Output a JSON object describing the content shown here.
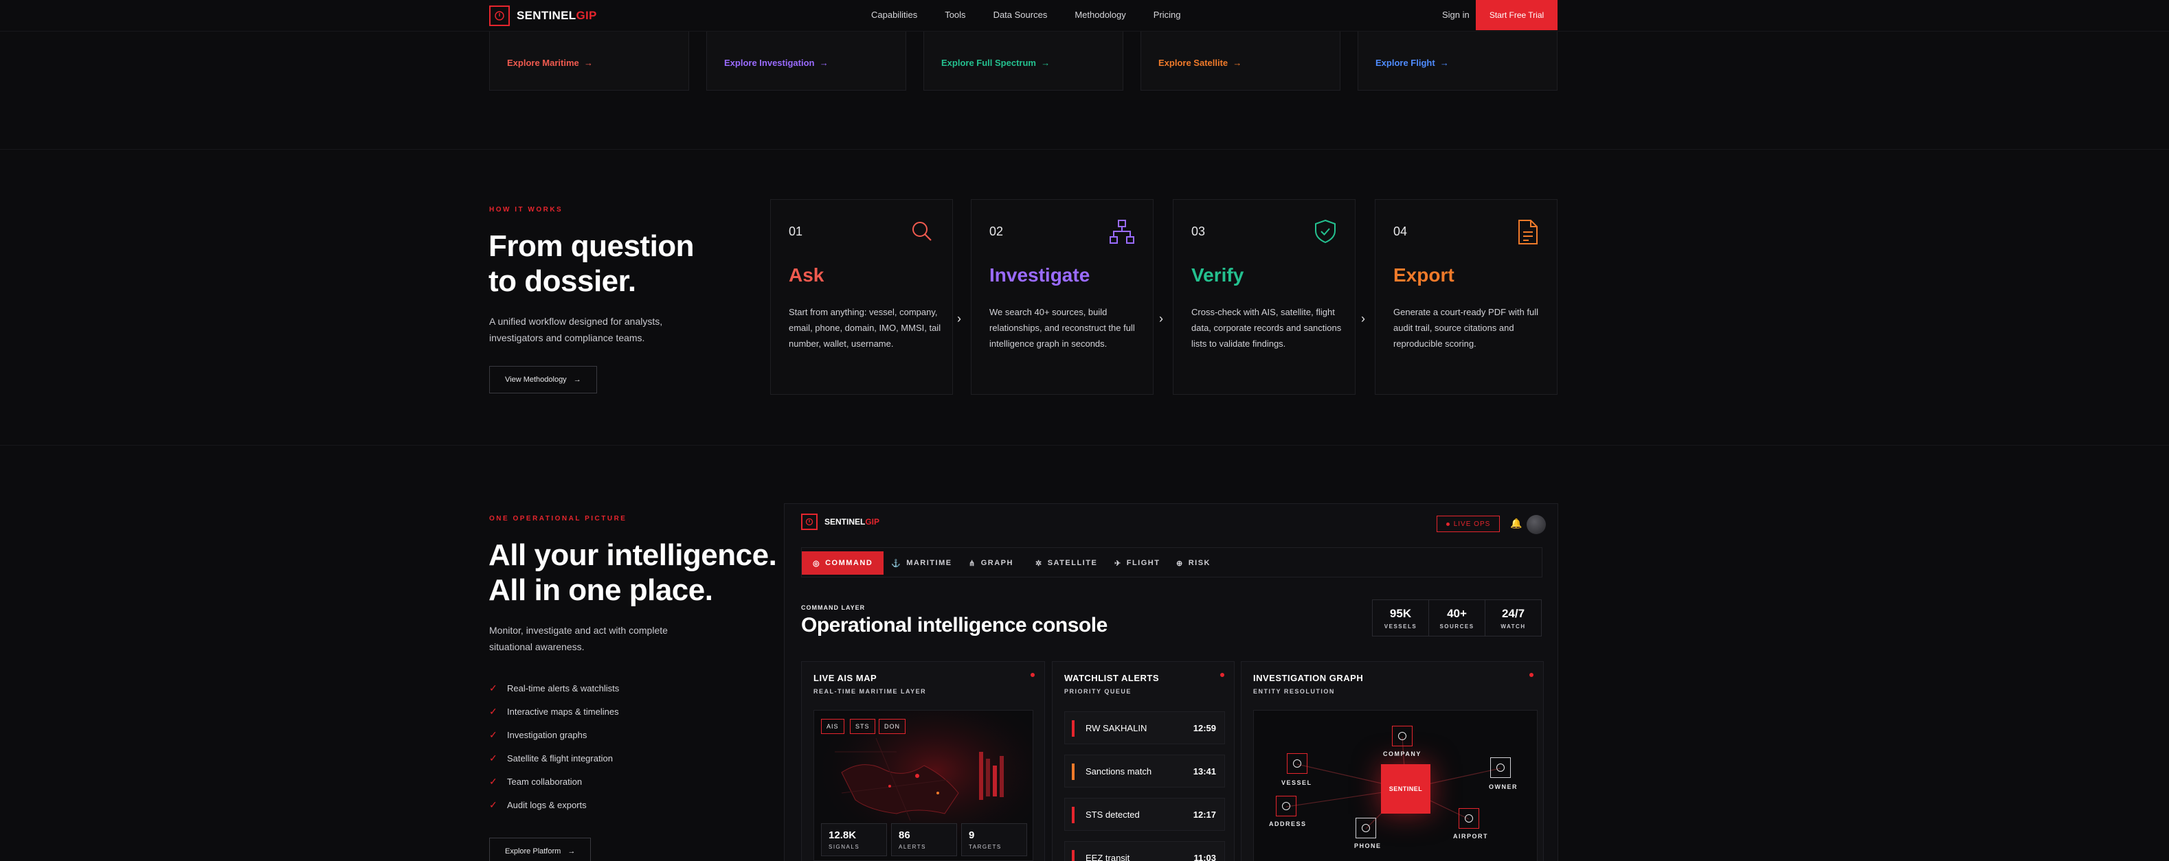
{
  "brand": {
    "name_main": "SENTINEL",
    "name_accent": "GIP",
    "accent_color": "#e5252d"
  },
  "nav": {
    "links": [
      "Capabilities",
      "Tools",
      "Data Sources",
      "Methodology",
      "Pricing"
    ],
    "sign_in": "Sign in",
    "cta": "Start Free Trial"
  },
  "top_cards": [
    {
      "link": "Explore Maritime",
      "color": "#f05a4f"
    },
    {
      "link": "Explore Investigation",
      "color": "#9a6bff"
    },
    {
      "link": "Explore Full Spectrum",
      "color": "#24c08f"
    },
    {
      "link": "Explore Satellite",
      "color": "#f07a2a"
    },
    {
      "link": "Explore Flight",
      "color": "#4f8cff"
    }
  ],
  "how": {
    "eyebrow": "HOW IT WORKS",
    "title_line1": "From question",
    "title_line2": "to dossier.",
    "lead": "A unified workflow designed for analysts, investigators and compliance teams.",
    "button": "View Methodology",
    "steps": [
      {
        "num": "01",
        "title": "Ask",
        "color": "#f05a4f",
        "icon": "search-icon",
        "text": "Start from anything: vessel, company, email, phone, domain, IMO, MMSI, tail number, wallet, username."
      },
      {
        "num": "02",
        "title": "Investigate",
        "color": "#9a6bff",
        "icon": "network-icon",
        "text": "We search 40+ sources, build relationships, and reconstruct the full intelligence graph in seconds."
      },
      {
        "num": "03",
        "title": "Verify",
        "color": "#24c08f",
        "icon": "shield-check-icon",
        "text": "Cross-check with AIS, satellite, flight data, corporate records and sanctions lists to validate findings."
      },
      {
        "num": "04",
        "title": "Export",
        "color": "#f07a2a",
        "icon": "document-icon",
        "text": "Generate a court-ready PDF with full audit trail, source citations and reproducible scoring."
      }
    ]
  },
  "operational": {
    "eyebrow": "ONE OPERATIONAL PICTURE",
    "title_line1": "All your intelligence.",
    "title_line2": "All in one place.",
    "lead": "Monitor, investigate and act with complete situational awareness.",
    "checks": [
      "Real-time alerts & watchlists",
      "Interactive maps & timelines",
      "Investigation graphs",
      "Satellite & flight integration",
      "Team collaboration",
      "Audit logs & exports"
    ],
    "button": "Explore Platform"
  },
  "console": {
    "brand_main": "SENTINEL",
    "brand_accent": "GIP",
    "live_ops": "LIVE OPS",
    "tabs": [
      "COMMAND",
      "MARITIME",
      "GRAPH",
      "SATELLITE",
      "FLIGHT",
      "RISK"
    ],
    "eyebrow": "COMMAND LAYER",
    "title": "Operational intelligence console",
    "stats": [
      {
        "value": "95K",
        "label": "VESSELS"
      },
      {
        "value": "40+",
        "label": "SOURCES"
      },
      {
        "value": "24/7",
        "label": "WATCH"
      }
    ],
    "map_panel": {
      "title": "LIVE AIS MAP",
      "subtitle": "REAL-TIME MARITIME LAYER",
      "chips": [
        "AIS",
        "STS",
        "DON"
      ],
      "stats": [
        {
          "value": "12.8K",
          "label": "SIGNALS"
        },
        {
          "value": "86",
          "label": "ALERTS"
        },
        {
          "value": "9",
          "label": "TARGETS"
        }
      ]
    },
    "alerts_panel": {
      "title": "WATCHLIST ALERTS",
      "subtitle": "PRIORITY QUEUE",
      "items": [
        {
          "name": "RW SAKHALIN",
          "time": "12:59",
          "color": "#e5252d"
        },
        {
          "name": "Sanctions match",
          "time": "13:41",
          "color": "#f07a2a"
        },
        {
          "name": "STS detected",
          "time": "12:17",
          "color": "#e5252d"
        },
        {
          "name": "EEZ transit",
          "time": "11:03",
          "color": "#e5252d"
        }
      ]
    },
    "graph_panel": {
      "title": "INVESTIGATION GRAPH",
      "subtitle": "ENTITY RESOLUTION",
      "center": "SENTINEL",
      "nodes": [
        "COMPANY",
        "VESSEL",
        "OWNER",
        "ADDRESS",
        "PHONE",
        "AIRPORT"
      ]
    }
  }
}
